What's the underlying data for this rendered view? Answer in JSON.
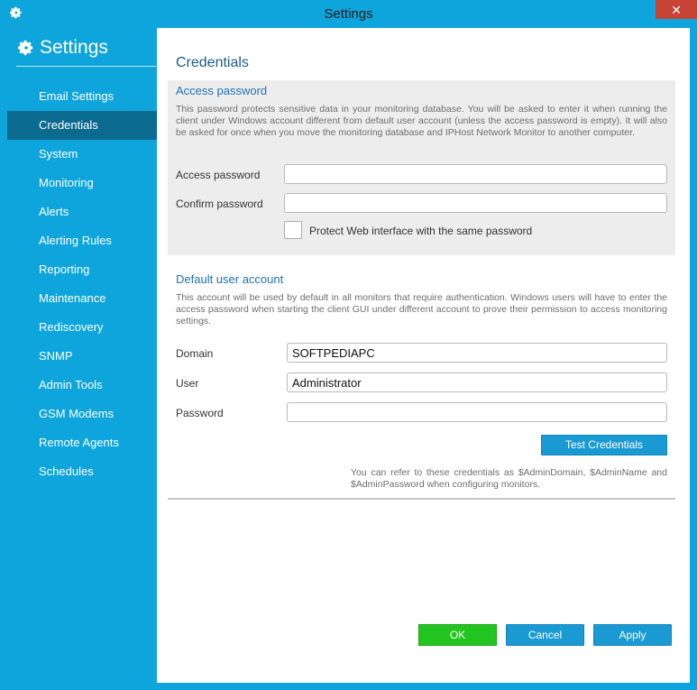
{
  "window": {
    "title": "Settings"
  },
  "sidebar": {
    "header": "Settings",
    "items": [
      {
        "label": "Email Settings"
      },
      {
        "label": "Credentials"
      },
      {
        "label": "System"
      },
      {
        "label": "Monitoring"
      },
      {
        "label": "Alerts"
      },
      {
        "label": "Alerting Rules"
      },
      {
        "label": "Reporting"
      },
      {
        "label": "Maintenance"
      },
      {
        "label": "Rediscovery"
      },
      {
        "label": "SNMP"
      },
      {
        "label": "Admin Tools"
      },
      {
        "label": "GSM Modems"
      },
      {
        "label": "Remote Agents"
      },
      {
        "label": "Schedules"
      }
    ],
    "active_index": 1
  },
  "main": {
    "title": "Credentials",
    "access": {
      "heading": "Access password",
      "description": "This password protects sensitive data in your monitoring database. You will be asked to enter it when running the client under Windows account different from default user account (unless the access password is empty). It will also be asked for once when you move the monitoring database and IPHost Network Monitor to another computer.",
      "password_label": "Access password",
      "password_value": "",
      "confirm_label": "Confirm password",
      "confirm_value": "",
      "protect_web_label": "Protect Web interface with the same password",
      "protect_web_checked": false
    },
    "default_user": {
      "heading": "Default user account",
      "description": "This account will be used by default in all monitors that require authentication. Windows users will have to enter the access password when starting the client GUI under different account to prove their permission to access monitoring settings.",
      "domain_label": "Domain",
      "domain_value": "SOFTPEDIAPC",
      "user_label": "User",
      "user_value": "Administrator",
      "password_label": "Password",
      "password_value": "",
      "test_button": "Test Credentials",
      "note": "You can refer to these credentials as $AdminDomain, $AdminName and $AdminPassword when configuring monitors."
    }
  },
  "footer": {
    "ok": "OK",
    "cancel": "Cancel",
    "apply": "Apply"
  },
  "colors": {
    "sidebar": "#0ea5dc",
    "active_item": "#0b6a90",
    "ok_button": "#22c520",
    "blue_button": "#1a9ad3",
    "close_button": "#c74335"
  }
}
